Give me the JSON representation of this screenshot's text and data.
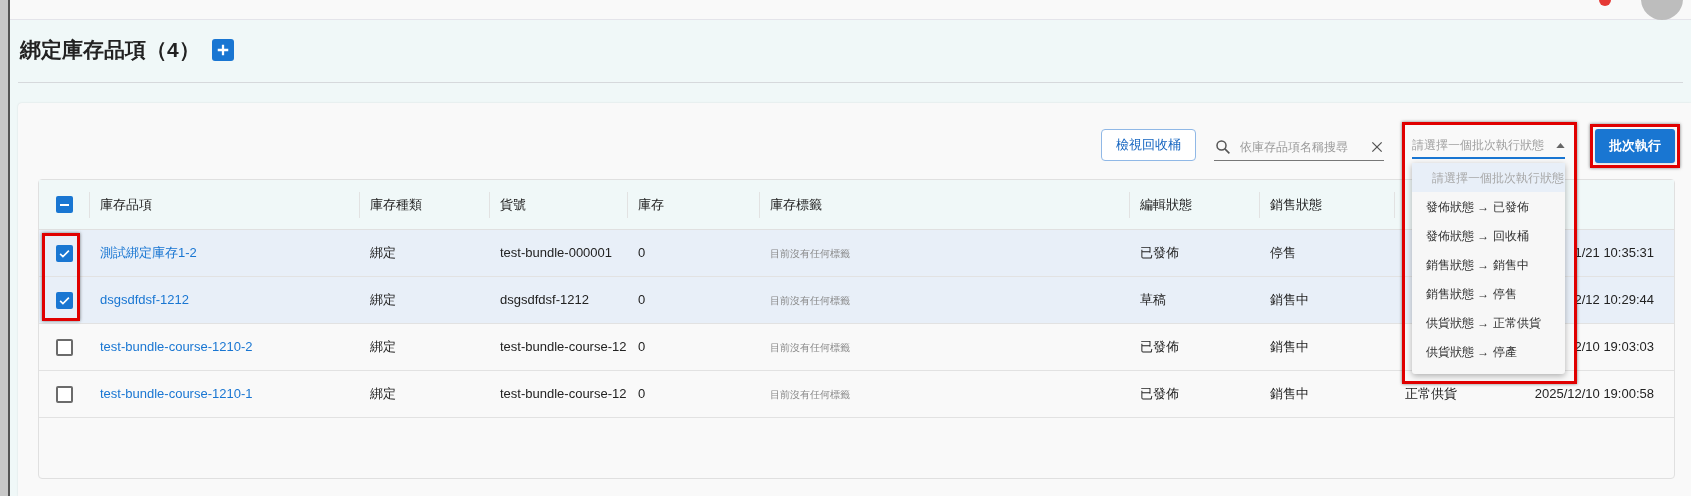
{
  "page": {
    "title": "綁定庫存品項（4）"
  },
  "toolbar": {
    "recycle_button": "檢視回收桶",
    "search": {
      "placeholder": "依庫存品項名稱搜尋"
    },
    "status_select": {
      "placeholder": "請選擇一個批次執行狀態",
      "expanded": true
    },
    "batch_button": "批次執行"
  },
  "status_options": [
    {
      "label": "請選擇一個批次執行狀態",
      "selected": true,
      "disabled": true
    },
    {
      "label": "發佈狀態 → 已發佈",
      "selected": false,
      "disabled": false
    },
    {
      "label": "發佈狀態 → 回收桶",
      "selected": false,
      "disabled": false
    },
    {
      "label": "銷售狀態 → 銷售中",
      "selected": false,
      "disabled": false
    },
    {
      "label": "銷售狀態 → 停售",
      "selected": false,
      "disabled": false
    },
    {
      "label": "供貨狀態 → 正常供貨",
      "selected": false,
      "disabled": false
    },
    {
      "label": "供貨狀態 → 停產",
      "selected": false,
      "disabled": false
    }
  ],
  "table": {
    "select_all_partial": true,
    "columns": [
      "庫存品項",
      "庫存種類",
      "貨號",
      "庫存",
      "庫存標籤",
      "編輯狀態",
      "銷售狀態"
    ],
    "rows": [
      {
        "selected": true,
        "name": "測試綁定庫存1-2",
        "type": "綁定",
        "sku": "test-bundle-000001",
        "stock": "0",
        "tags": "目前沒有任何標籤",
        "edit_status": "已發佈",
        "sale_status": "停售",
        "date": "1/21 10:35:31"
      },
      {
        "selected": true,
        "name": "dsgsdfdsf-1212",
        "type": "綁定",
        "sku": "dsgsdfdsf-1212",
        "stock": "0",
        "tags": "目前沒有任何標籤",
        "edit_status": "草稿",
        "sale_status": "銷售中",
        "date": "2/12 10:29:44"
      },
      {
        "selected": false,
        "name": "test-bundle-course-1210-2",
        "type": "綁定",
        "sku": "test-bundle-course-12",
        "stock": "0",
        "tags": "目前沒有任何標籤",
        "edit_status": "已發佈",
        "sale_status": "銷售中",
        "date": "2/10 19:03:03"
      },
      {
        "selected": false,
        "name": "test-bundle-course-1210-1",
        "type": "綁定",
        "sku": "test-bundle-course-12",
        "stock": "0",
        "tags": "目前沒有任何標籤",
        "edit_status": "已發佈",
        "sale_status": "銷售中",
        "supply_status": "正常供貨",
        "date": "2025/12/10 19:00:58"
      }
    ]
  },
  "highlights": {
    "row_checkboxes": true,
    "status_select": true,
    "batch_button": true
  }
}
